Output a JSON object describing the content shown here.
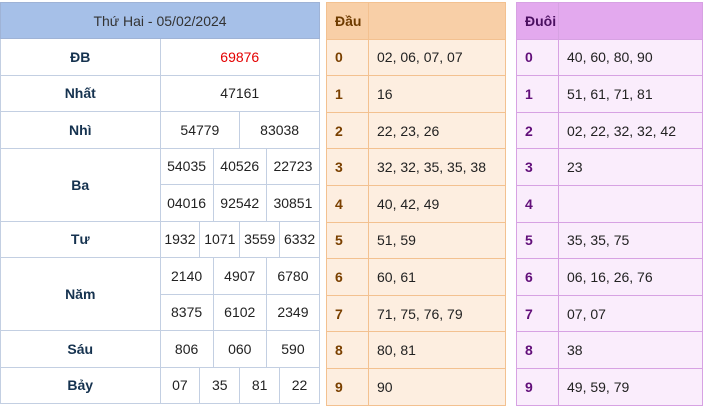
{
  "results": {
    "title": "Thứ Hai - 05/02/2024",
    "rows": [
      {
        "label": "ĐB",
        "lines": [
          [
            "69876"
          ]
        ],
        "special": true
      },
      {
        "label": "Nhất",
        "lines": [
          [
            "47161"
          ]
        ]
      },
      {
        "label": "Nhì",
        "lines": [
          [
            "54779",
            "83038"
          ]
        ]
      },
      {
        "label": "Ba",
        "lines": [
          [
            "54035",
            "40526",
            "22723"
          ],
          [
            "04016",
            "92542",
            "30851"
          ]
        ]
      },
      {
        "label": "Tư",
        "lines": [
          [
            "1932",
            "1071",
            "3559",
            "6332"
          ]
        ]
      },
      {
        "label": "Năm",
        "lines": [
          [
            "2140",
            "4907",
            "6780"
          ],
          [
            "8375",
            "6102",
            "2349"
          ]
        ]
      },
      {
        "label": "Sáu",
        "lines": [
          [
            "806",
            "060",
            "590"
          ]
        ]
      },
      {
        "label": "Bảy",
        "lines": [
          [
            "07",
            "35",
            "81",
            "22"
          ]
        ]
      }
    ],
    "colors": {
      "header_bg": "#a6c0e8",
      "special": "#e40000"
    }
  },
  "dau": {
    "header": "Đầu",
    "rows": [
      {
        "num": "0",
        "vals": "02, 06, 07, 07"
      },
      {
        "num": "1",
        "vals": "16"
      },
      {
        "num": "2",
        "vals": "22, 23, 26"
      },
      {
        "num": "3",
        "vals": "32, 32, 35, 35, 38"
      },
      {
        "num": "4",
        "vals": "40, 42, 49"
      },
      {
        "num": "5",
        "vals": "51, 59"
      },
      {
        "num": "6",
        "vals": "60, 61"
      },
      {
        "num": "7",
        "vals": "71, 75, 76, 79"
      },
      {
        "num": "8",
        "vals": "80, 81"
      },
      {
        "num": "9",
        "vals": "90"
      }
    ],
    "colors": {
      "bg": "#fdeee0",
      "header_bg": "#f8cfa7"
    }
  },
  "duoi": {
    "header": "Đuôi",
    "rows": [
      {
        "num": "0",
        "vals": "40, 60, 80, 90"
      },
      {
        "num": "1",
        "vals": "51, 61, 71, 81"
      },
      {
        "num": "2",
        "vals": "02, 22, 32, 32, 42"
      },
      {
        "num": "3",
        "vals": "23"
      },
      {
        "num": "4",
        "vals": ""
      },
      {
        "num": "5",
        "vals": "35, 35, 75"
      },
      {
        "num": "6",
        "vals": "06, 16, 26, 76"
      },
      {
        "num": "7",
        "vals": "07, 07"
      },
      {
        "num": "8",
        "vals": "38"
      },
      {
        "num": "9",
        "vals": "49, 59, 79"
      }
    ],
    "colors": {
      "bg": "#faedfc",
      "header_bg": "#e3a9ee"
    }
  }
}
